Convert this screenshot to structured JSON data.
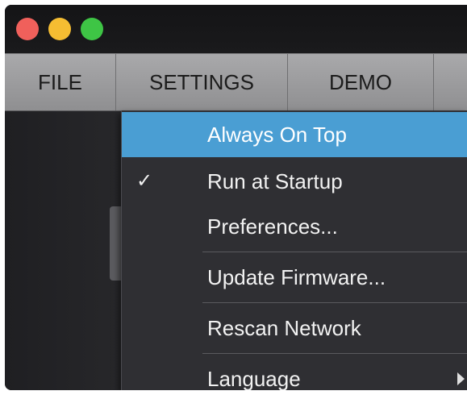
{
  "menubar": {
    "tabs": [
      {
        "label": "FILE"
      },
      {
        "label": "SETTINGS"
      },
      {
        "label": "DEMO"
      }
    ]
  },
  "settings_menu": {
    "items": [
      {
        "label": "Always On Top",
        "checked": false,
        "highlighted": true
      },
      {
        "label": "Run at Startup",
        "checked": true,
        "check_glyph": "✓"
      },
      {
        "label": "Preferences..."
      },
      {
        "label": "Update Firmware..."
      },
      {
        "label": "Rescan Network"
      },
      {
        "label": "Language",
        "has_submenu": true
      }
    ]
  },
  "colors": {
    "highlight": "#4a9ed3",
    "traffic_close": "#f0605b",
    "traffic_minimize": "#f5bd32",
    "traffic_zoom": "#3ec545"
  }
}
